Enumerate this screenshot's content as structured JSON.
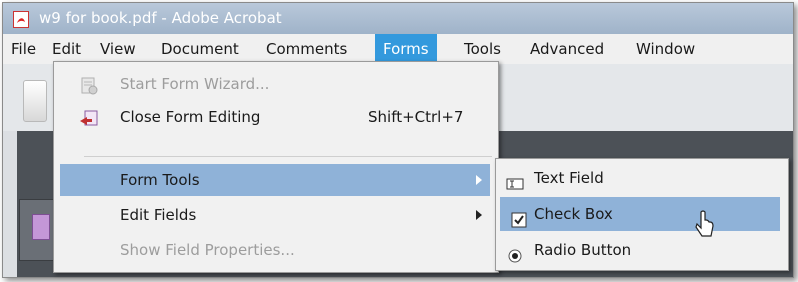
{
  "window": {
    "title": "w9 for book.pdf - Adobe Acrobat",
    "title_icon": "pdf-icon"
  },
  "menubar": {
    "items": [
      {
        "label": "File"
      },
      {
        "label": "Edit"
      },
      {
        "label": "View"
      },
      {
        "label": "Document"
      },
      {
        "label": "Comments"
      },
      {
        "label": "Forms",
        "active": true
      },
      {
        "label": "Tools"
      },
      {
        "label": "Advanced"
      },
      {
        "label": "Window"
      }
    ]
  },
  "forms_menu": {
    "items": [
      {
        "label": "Start Form Wizard...",
        "enabled": false,
        "icon": "form-wizard-icon"
      },
      {
        "label": "Close Form Editing",
        "shortcut": "Shift+Ctrl+7",
        "enabled": true,
        "icon": "close-form-editing-icon"
      },
      {
        "label": "Form Tools",
        "enabled": true,
        "highlighted": true,
        "submenu": true
      },
      {
        "label": "Edit Fields",
        "enabled": true,
        "submenu": true
      },
      {
        "label": "Show Field Properties...",
        "enabled": false
      }
    ]
  },
  "form_tools_submenu": {
    "items": [
      {
        "label": "Text Field",
        "icon": "text-field-icon"
      },
      {
        "label": "Check Box",
        "icon": "checkbox-icon",
        "highlighted": true
      },
      {
        "label": "Radio Button",
        "icon": "radio-button-icon"
      }
    ]
  },
  "colors": {
    "menu_active": "#3399dd",
    "menu_highlight": "#8fb2d8",
    "titlebar": "#9fb3c9"
  }
}
